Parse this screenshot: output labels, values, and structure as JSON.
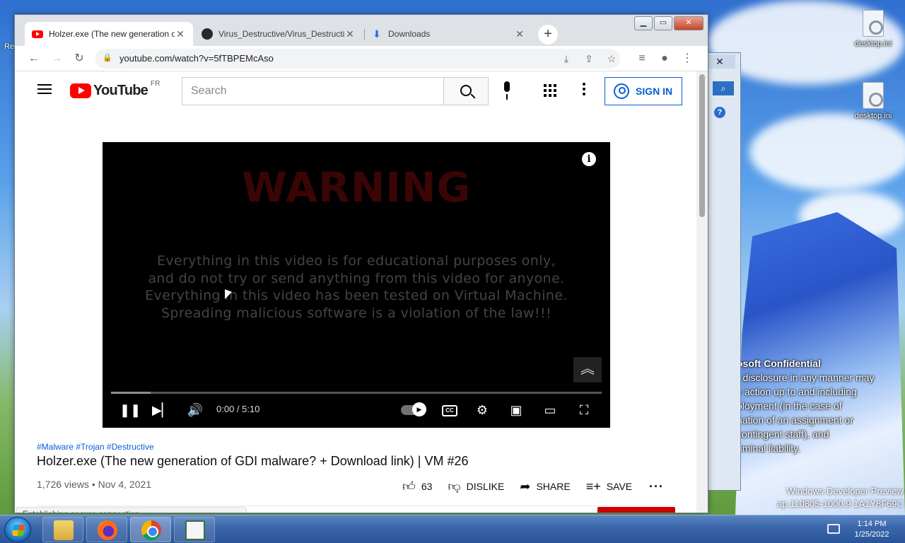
{
  "desktop": {
    "icons": [
      {
        "label": "desktop.ini"
      },
      {
        "label": "desktop.ini"
      }
    ],
    "left_label": "Re",
    "overlay_text": {
      "header": "osoft Confidential",
      "lines": [
        "r disclosure in any manner may",
        "y action up to and including",
        "ployment (in the case of",
        "nation of an assignment or",
        "contingent staff), and",
        "riminal liability."
      ]
    },
    "watermark": {
      "line1": "Windows Developer Preview",
      "line2": "ap.110805-1000.9",
      "line3": "1A1Y8F69C"
    }
  },
  "browser": {
    "tabs": [
      {
        "title": "Holzer.exe (The new generation of",
        "icon": "youtube-icon",
        "active": true
      },
      {
        "title": "Virus_Destructive/Virus_Destructive",
        "icon": "github-icon",
        "active": false
      },
      {
        "title": "Downloads",
        "icon": "download-icon",
        "active": false
      }
    ],
    "url": "youtube.com/watch?v=5fTBPEMcAso",
    "status_text": "Establishing secure connection..."
  },
  "youtube": {
    "logo_text": "YouTube",
    "region": "FR",
    "search_placeholder": "Search",
    "sign_in": "SIGN IN",
    "video": {
      "warning": "WARNING",
      "disclaimer": [
        "Everything in this video is for educational purposes only,",
        "and do not try or send anything from this video for anyone.",
        "Everything in this video has been tested on Virtual Machine.",
        "Spreading malicious software is a violation of the law!!!"
      ],
      "time": "0:00 / 5:10",
      "progress": 0.0,
      "buffered": 0.08
    },
    "hashtags": "#Malware #Trojan #Destructive",
    "title": "Holzer.exe (The new generation of GDI malware? + Download link) | VM #26",
    "meta": "1,726 views • Nov 4, 2021",
    "actions": {
      "likes": "63",
      "dislike": "DISLIKE",
      "share": "SHARE",
      "save": "SAVE"
    }
  },
  "taskbar": {
    "clock_time": "1:14 PM",
    "clock_date": "1/25/2022"
  }
}
